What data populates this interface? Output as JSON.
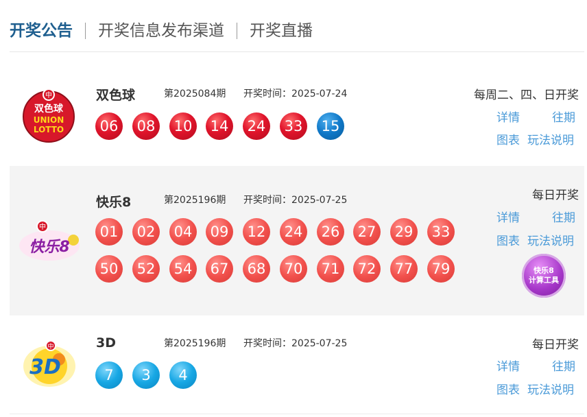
{
  "tabs": [
    "开奖公告",
    "开奖信息发布渠道",
    "开奖直播"
  ],
  "games": [
    {
      "name": "双色球",
      "issue": "第2025084期",
      "date": "开奖时间：2025-07-24",
      "schedule": "每周二、四、日开奖",
      "logo_text": [
        "双色球",
        "UNION",
        "LOTTO"
      ],
      "red_balls": [
        "06",
        "08",
        "10",
        "14",
        "24",
        "33"
      ],
      "blue_balls": [
        "15"
      ]
    },
    {
      "name": "快乐8",
      "issue": "第2025196期",
      "date": "开奖时间：2025-07-25",
      "schedule": "每日开奖",
      "logo_text": "快乐8",
      "balls_row1": [
        "01",
        "02",
        "04",
        "09",
        "12",
        "24",
        "26",
        "27",
        "29",
        "33"
      ],
      "balls_row2": [
        "50",
        "52",
        "54",
        "67",
        "68",
        "70",
        "71",
        "72",
        "77",
        "79"
      ],
      "calc_tool": [
        "快乐8",
        "计算工具"
      ]
    },
    {
      "name": "3D",
      "issue": "第2025196期",
      "date": "开奖时间：2025-07-25",
      "schedule": "每日开奖",
      "logo_text": "3D",
      "balls": [
        "7",
        "3",
        "4"
      ]
    }
  ],
  "links": {
    "detail": "详情",
    "history": "往期",
    "chart": "图表",
    "rules": "玩法说明"
  },
  "colors": {
    "tab_active": "#1f5f8f",
    "link": "#4a9ad8",
    "red_ball": "#e0142b",
    "blue_ball": "#0f78c8",
    "coral_ball": "#f2514d",
    "sky_ball": "#17a7e4"
  }
}
